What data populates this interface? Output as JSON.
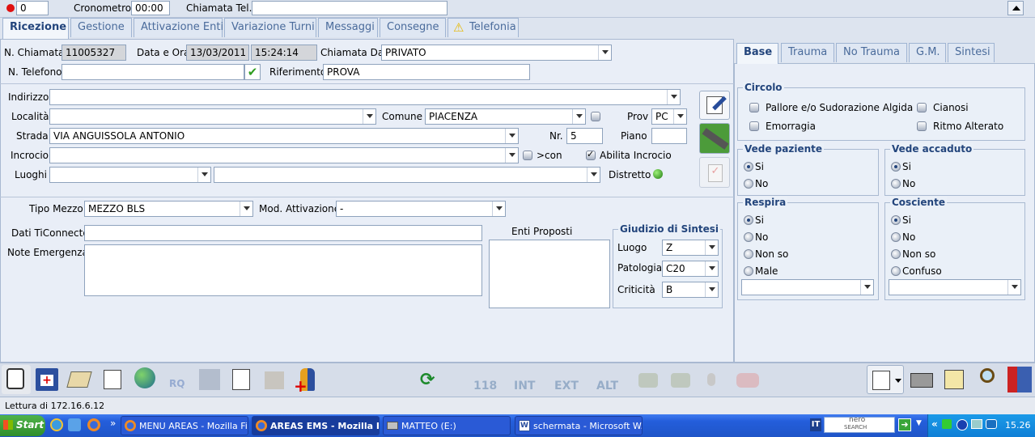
{
  "topbar": {
    "counter": "0",
    "cronometro_label": "Cronometro",
    "cronometro_value": "00:00",
    "chiamata_tel_label": "Chiamata Tel.",
    "chiamata_tel_value": ""
  },
  "main_tabs": [
    "Ricezione",
    "Gestione",
    "Attivazione Enti",
    "Variazione Turni",
    "Messaggi",
    "Consegne",
    "Telefonia"
  ],
  "call": {
    "n_chiamata_label": "N. Chiamata",
    "n_chiamata": "11005327",
    "data_ora_label": "Data e Ora",
    "data": "13/03/2011",
    "ora": "15:24:14",
    "chiamata_da_label": "Chiamata Da",
    "chiamata_da": "PRIVATO",
    "n_telefono_label": "N. Telefono",
    "n_telefono": "",
    "riferimento_label": "Riferimento",
    "riferimento": "PROVA"
  },
  "address": {
    "indirizzo_label": "Indirizzo",
    "indirizzo": "",
    "localita_label": "Località",
    "localita": "",
    "comune_label": "Comune",
    "comune": "PIACENZA",
    "prov_label": "Prov",
    "prov": "PC",
    "strada_label": "Strada",
    "strada": "VIA ANGUISSOLA ANTONIO",
    "nr_label": "Nr.",
    "nr": "5",
    "piano_label": "Piano",
    "piano": "",
    "incrocio_label": "Incrocio",
    "incrocio": "",
    "con_label": ">con",
    "abilita_incrocio_label": "Abilita Incrocio",
    "luoghi_label": "Luoghi",
    "luoghi": "",
    "luoghi2": "",
    "distretto_label": "Distretto"
  },
  "mezzo": {
    "tipo_mezzo_label": "Tipo Mezzo",
    "tipo_mezzo": "MEZZO BLS",
    "mod_attivazione_label": "Mod. Attivazione",
    "mod_attivazione": "-",
    "dati_ticonnecto_label": "Dati TiConnecto",
    "dati_ticonnecto": "",
    "note_emergenza_label": "Note Emergenza",
    "note_emergenza": "",
    "enti_proposti_label": "Enti Proposti"
  },
  "giudizio": {
    "title": "Giudizio di Sintesi",
    "luogo_label": "Luogo",
    "luogo": "Z",
    "patologia_label": "Patologia",
    "patologia": "C20",
    "criticita_label": "Criticità",
    "criticita": "B"
  },
  "right_tabs": [
    "Base",
    "Trauma",
    "No Trauma",
    "G.M.",
    "Sintesi"
  ],
  "circolo": {
    "title": "Circolo",
    "items": [
      "Pallore e/o Sudorazione Algida",
      "Cianosi",
      "Emorragia",
      "Ritmo Alterato"
    ]
  },
  "vede_paziente": {
    "title": "Vede paziente",
    "options": [
      "Si",
      "No"
    ],
    "selected": "Si"
  },
  "vede_accaduto": {
    "title": "Vede accaduto",
    "options": [
      "Si",
      "No"
    ],
    "selected": "Si"
  },
  "respira": {
    "title": "Respira",
    "options": [
      "Si",
      "No",
      "Non so",
      "Male"
    ],
    "selected": "Si"
  },
  "cosciente": {
    "title": "Cosciente",
    "options": [
      "Si",
      "No",
      "Non so",
      "Confuso"
    ],
    "selected": "Si"
  },
  "toolbar_mid": [
    "118",
    "INT",
    "EXT",
    "ALT"
  ],
  "status": "Lettura di 172.16.6.12",
  "taskbar": {
    "start": "Start",
    "items": [
      "MENU AREAS - Mozilla Fir...",
      "AREAS EMS - Mozilla F...",
      "MATTEO (E:)",
      "schermata - Microsoft W..."
    ],
    "search_top": "nero",
    "search_bottom": "SEARCH",
    "clock": "15.26"
  },
  "colors": {
    "accent": "#23457c",
    "bg": "#dde4ef",
    "panel": "#e9eef7",
    "taskbar": "#245edb"
  }
}
